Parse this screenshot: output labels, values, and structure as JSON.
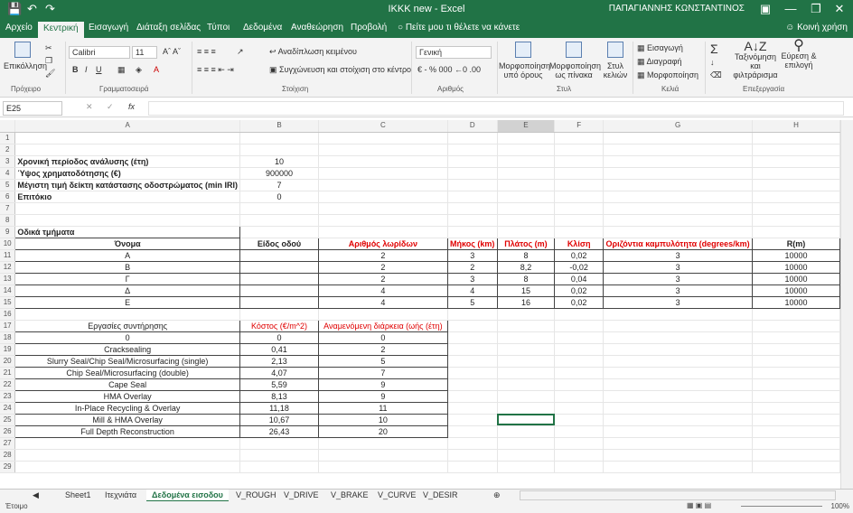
{
  "titlebar": {
    "title": "ΙΚΚΚ new  -  Excel",
    "user": "ΠΑΠΑΓΙΑΝΝΗΣ ΚΩΝΣΤΑΝΤΙΝΟΣ"
  },
  "tabs": [
    "Αρχείο",
    "Κεντρική",
    "Εισαγωγή",
    "Διάταξη σελίδας",
    "Τύποι",
    "Δεδομένα",
    "Αναθεώρηση",
    "Προβολή"
  ],
  "tellme": "Πείτε μου τι θέλετε να κάνετε",
  "share": "Κοινή χρήση",
  "ribbon": {
    "paste": "Επικόλληση",
    "font_name": "Calibri",
    "font_size": "11",
    "wrap": "Αναδίπλωση κειμένου",
    "merge": "Συγχώνευση και στοίχιση στο κέντρο",
    "number_format": "Γενική",
    "cond_format": "Μορφοποίηση υπό όρους",
    "format_table": "Μορφοποίηση ως πίνακα",
    "cell_styles": "Στυλ κελιών",
    "insert": "Εισαγωγή",
    "delete": "Διαγραφή",
    "format": "Μορφοποίηση",
    "sort": "Ταξινόμηση και φιλτράρισμα",
    "find": "Εύρεση & επιλογή",
    "groups": [
      "Πρόχειρο",
      "Γραμματοσειρά",
      "Στοίχιση",
      "Αριθμός",
      "Στυλ",
      "Κελιά",
      "Επεξεργασία"
    ]
  },
  "namebox": "E25",
  "columns": [
    "A",
    "B",
    "C",
    "D",
    "E",
    "F",
    "G",
    "H"
  ],
  "params": [
    {
      "label": "Χρονική περίοδος ανάλυσης (έτη)",
      "value": "10"
    },
    {
      "label": "Ύψος χρηματοδότησης (€)",
      "value": "900000"
    },
    {
      "label": "Μέγιστη τιμή δείκτη κατάστασης οδοστρώματος (min IRI)",
      "value": "7"
    },
    {
      "label": "Επιτόκιο",
      "value": "0"
    }
  ],
  "segments_title": "Οδικά τμήματα",
  "seg_headers": [
    "Όνομα",
    "Είδος οδού",
    "Αριθμός λωρίδων",
    "Μήκος (km)",
    "Πλάτος (m)",
    "Κλίση",
    "Οριζόντια καμπυλότητα (degrees/km)",
    "R(m)"
  ],
  "segments": [
    [
      "Α",
      "",
      "2",
      "3",
      "8",
      "0,02",
      "3",
      "10000"
    ],
    [
      "Β",
      "",
      "2",
      "2",
      "8,2",
      "-0,02",
      "3",
      "10000"
    ],
    [
      "Γ",
      "",
      "2",
      "3",
      "8",
      "0,04",
      "3",
      "10000"
    ],
    [
      "Δ",
      "",
      "4",
      "4",
      "15",
      "0,02",
      "3",
      "10000"
    ],
    [
      "Ε",
      "",
      "4",
      "5",
      "16",
      "0,02",
      "3",
      "10000"
    ]
  ],
  "maint_headers": [
    "Εργασίες συντήρησης",
    "Κόστος (€/m^2)",
    "Αναμενόμενη διάρκεια (ωής (έτη)"
  ],
  "maintenance": [
    [
      "0",
      "0",
      "0"
    ],
    [
      "Cracksealing",
      "0,41",
      "2"
    ],
    [
      "Slurry Seal/Chip Seal/Microsurfacing (single)",
      "2,13",
      "5"
    ],
    [
      "Chip Seal/Microsurfacing (double)",
      "4,07",
      "7"
    ],
    [
      "Cape Seal",
      "5,59",
      "9"
    ],
    [
      "HMA Overlay",
      "8,13",
      "9"
    ],
    [
      "In-Place Recycling & Overlay",
      "11,18",
      "11"
    ],
    [
      "Mill & HMA Overlay",
      "10,67",
      "10"
    ],
    [
      "Full Depth Reconstruction",
      "26,43",
      "20"
    ]
  ],
  "sheet_tabs": [
    "Sheet1",
    "Ιτεχνιάτα",
    "Δεδομένα εισοδου",
    "V_ROUGH",
    "V_DRIVE",
    "V_BRAKE",
    "V_CURVE",
    "V_DESIR"
  ],
  "status": {
    "ready": "Έτοιμο",
    "zoom": "100%"
  }
}
